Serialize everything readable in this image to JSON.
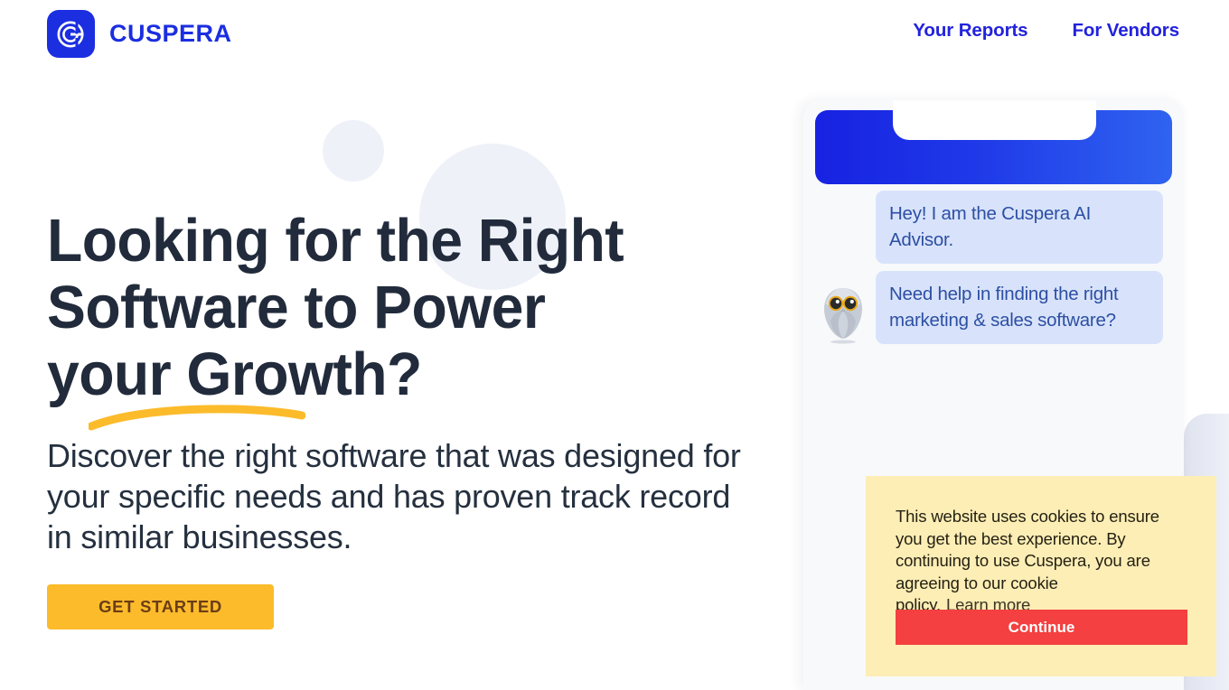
{
  "brand": {
    "name": "CUSPERA",
    "logo_icon": "cuspera-c-logo-icon",
    "logo_color": "#1b2ee0",
    "wordmark_color": "#1b2ee0"
  },
  "nav": {
    "items": [
      {
        "label": "Your Reports",
        "name": "nav-your-reports"
      },
      {
        "label": "For Vendors",
        "name": "nav-for-vendors"
      }
    ],
    "link_color": "#2222dd"
  },
  "hero": {
    "title": "Looking for the Right Software to Power your Growth?",
    "title_color": "#212b3b",
    "underline_color": "#fcbb2b",
    "subtitle": "Discover the right software that was designed for your specific needs and has proven track record in similar businesses.",
    "subtitle_color": "#25303f",
    "cta_label": "GET STARTED",
    "cta_bg": "#fcbb2b",
    "cta_text_color": "#6b3d16"
  },
  "decor": {
    "circle_color": "#eef1f8"
  },
  "phone": {
    "header_gradient_start": "#1722e2",
    "header_gradient_end": "#2f63f0",
    "body_bg": "#f8f9fb",
    "avatar_icon": "owl-advisor-avatar-icon",
    "bubble_bg": "#d8e3fb",
    "bubble_text_color": "#2d4fa3",
    "messages": [
      {
        "text": "Hey! I am the Cuspera AI Advisor."
      },
      {
        "text": "Need help in finding the right marketing & sales software?"
      }
    ]
  },
  "cookie": {
    "bg": "#fceeb5",
    "body": "This website uses cookies to ensure you get the best experience. By continuing to use Cuspera, you are agreeing to our cookie policy.",
    "learn_more_label": "Learn more",
    "continue_label": "Continue",
    "continue_bg": "#f44040"
  }
}
